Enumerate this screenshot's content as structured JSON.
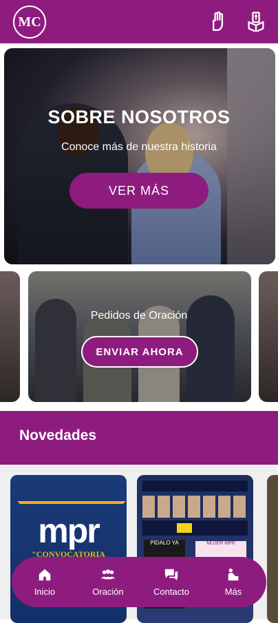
{
  "header": {
    "logo_text": "MC",
    "icons": [
      "prayer-hand-icon",
      "bible-icon"
    ]
  },
  "hero": {
    "title": "SOBRE NOSOTROS",
    "subtitle": "Conoce más de nuestra historia",
    "button_label": "VER MÁS"
  },
  "prayer_card": {
    "title": "Pedidos de Oración",
    "button_label": "ENVIAR AHORA"
  },
  "news": {
    "section_title": "Novedades",
    "items": [
      {
        "logo_text": "mpr",
        "caption": "\"CONVOCATORIA MUNDIAL\""
      },
      {
        "text_1": "PIDALO YA",
        "text_2": "MUJER MPR"
      }
    ]
  },
  "bottom_nav": {
    "items": [
      {
        "label": "Inicio",
        "icon": "home-icon"
      },
      {
        "label": "Oración",
        "icon": "group-icon"
      },
      {
        "label": "Contacto",
        "icon": "chat-icon"
      },
      {
        "label": "Más",
        "icon": "more-icon"
      }
    ]
  },
  "colors": {
    "primary": "#8e1c7e",
    "background": "#ffffff",
    "news_strip": "#efefef"
  }
}
